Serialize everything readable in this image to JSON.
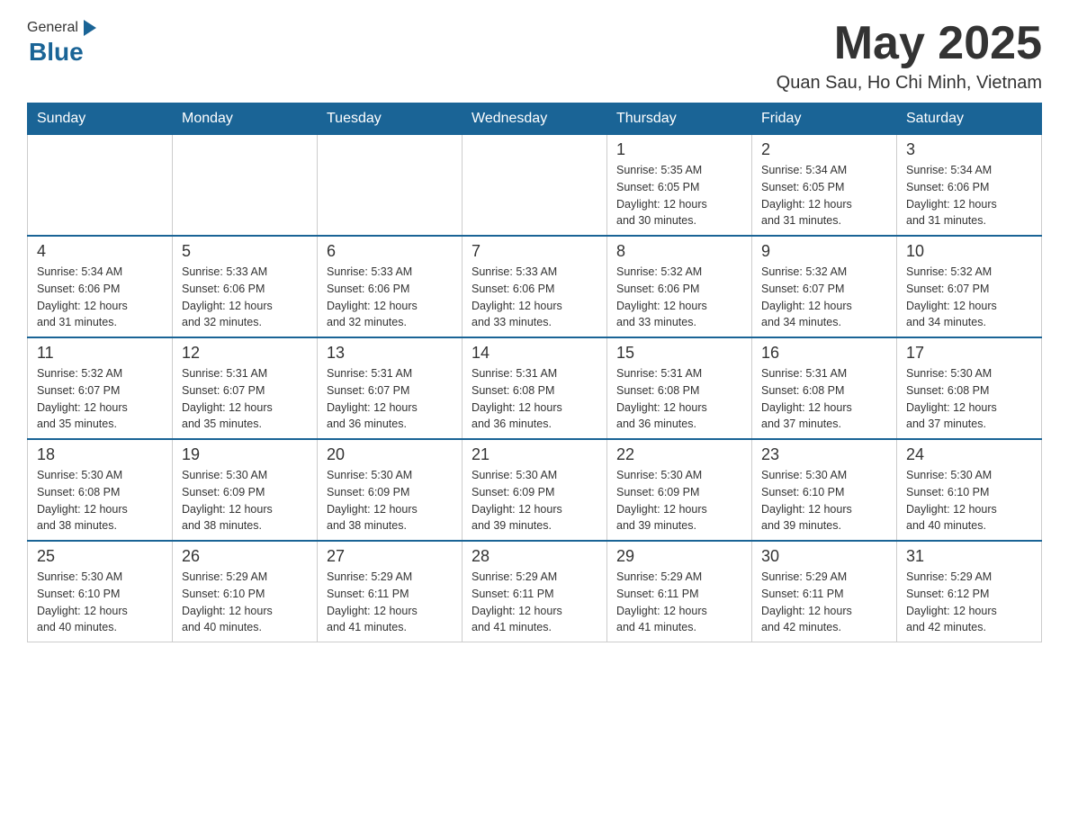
{
  "header": {
    "logo_general": "General",
    "logo_blue": "Blue",
    "month_title": "May 2025",
    "location": "Quan Sau, Ho Chi Minh, Vietnam"
  },
  "days_of_week": [
    "Sunday",
    "Monday",
    "Tuesday",
    "Wednesday",
    "Thursday",
    "Friday",
    "Saturday"
  ],
  "weeks": [
    [
      {
        "day": "",
        "info": ""
      },
      {
        "day": "",
        "info": ""
      },
      {
        "day": "",
        "info": ""
      },
      {
        "day": "",
        "info": ""
      },
      {
        "day": "1",
        "info": "Sunrise: 5:35 AM\nSunset: 6:05 PM\nDaylight: 12 hours\nand 30 minutes."
      },
      {
        "day": "2",
        "info": "Sunrise: 5:34 AM\nSunset: 6:05 PM\nDaylight: 12 hours\nand 31 minutes."
      },
      {
        "day": "3",
        "info": "Sunrise: 5:34 AM\nSunset: 6:06 PM\nDaylight: 12 hours\nand 31 minutes."
      }
    ],
    [
      {
        "day": "4",
        "info": "Sunrise: 5:34 AM\nSunset: 6:06 PM\nDaylight: 12 hours\nand 31 minutes."
      },
      {
        "day": "5",
        "info": "Sunrise: 5:33 AM\nSunset: 6:06 PM\nDaylight: 12 hours\nand 32 minutes."
      },
      {
        "day": "6",
        "info": "Sunrise: 5:33 AM\nSunset: 6:06 PM\nDaylight: 12 hours\nand 32 minutes."
      },
      {
        "day": "7",
        "info": "Sunrise: 5:33 AM\nSunset: 6:06 PM\nDaylight: 12 hours\nand 33 minutes."
      },
      {
        "day": "8",
        "info": "Sunrise: 5:32 AM\nSunset: 6:06 PM\nDaylight: 12 hours\nand 33 minutes."
      },
      {
        "day": "9",
        "info": "Sunrise: 5:32 AM\nSunset: 6:07 PM\nDaylight: 12 hours\nand 34 minutes."
      },
      {
        "day": "10",
        "info": "Sunrise: 5:32 AM\nSunset: 6:07 PM\nDaylight: 12 hours\nand 34 minutes."
      }
    ],
    [
      {
        "day": "11",
        "info": "Sunrise: 5:32 AM\nSunset: 6:07 PM\nDaylight: 12 hours\nand 35 minutes."
      },
      {
        "day": "12",
        "info": "Sunrise: 5:31 AM\nSunset: 6:07 PM\nDaylight: 12 hours\nand 35 minutes."
      },
      {
        "day": "13",
        "info": "Sunrise: 5:31 AM\nSunset: 6:07 PM\nDaylight: 12 hours\nand 36 minutes."
      },
      {
        "day": "14",
        "info": "Sunrise: 5:31 AM\nSunset: 6:08 PM\nDaylight: 12 hours\nand 36 minutes."
      },
      {
        "day": "15",
        "info": "Sunrise: 5:31 AM\nSunset: 6:08 PM\nDaylight: 12 hours\nand 36 minutes."
      },
      {
        "day": "16",
        "info": "Sunrise: 5:31 AM\nSunset: 6:08 PM\nDaylight: 12 hours\nand 37 minutes."
      },
      {
        "day": "17",
        "info": "Sunrise: 5:30 AM\nSunset: 6:08 PM\nDaylight: 12 hours\nand 37 minutes."
      }
    ],
    [
      {
        "day": "18",
        "info": "Sunrise: 5:30 AM\nSunset: 6:08 PM\nDaylight: 12 hours\nand 38 minutes."
      },
      {
        "day": "19",
        "info": "Sunrise: 5:30 AM\nSunset: 6:09 PM\nDaylight: 12 hours\nand 38 minutes."
      },
      {
        "day": "20",
        "info": "Sunrise: 5:30 AM\nSunset: 6:09 PM\nDaylight: 12 hours\nand 38 minutes."
      },
      {
        "day": "21",
        "info": "Sunrise: 5:30 AM\nSunset: 6:09 PM\nDaylight: 12 hours\nand 39 minutes."
      },
      {
        "day": "22",
        "info": "Sunrise: 5:30 AM\nSunset: 6:09 PM\nDaylight: 12 hours\nand 39 minutes."
      },
      {
        "day": "23",
        "info": "Sunrise: 5:30 AM\nSunset: 6:10 PM\nDaylight: 12 hours\nand 39 minutes."
      },
      {
        "day": "24",
        "info": "Sunrise: 5:30 AM\nSunset: 6:10 PM\nDaylight: 12 hours\nand 40 minutes."
      }
    ],
    [
      {
        "day": "25",
        "info": "Sunrise: 5:30 AM\nSunset: 6:10 PM\nDaylight: 12 hours\nand 40 minutes."
      },
      {
        "day": "26",
        "info": "Sunrise: 5:29 AM\nSunset: 6:10 PM\nDaylight: 12 hours\nand 40 minutes."
      },
      {
        "day": "27",
        "info": "Sunrise: 5:29 AM\nSunset: 6:11 PM\nDaylight: 12 hours\nand 41 minutes."
      },
      {
        "day": "28",
        "info": "Sunrise: 5:29 AM\nSunset: 6:11 PM\nDaylight: 12 hours\nand 41 minutes."
      },
      {
        "day": "29",
        "info": "Sunrise: 5:29 AM\nSunset: 6:11 PM\nDaylight: 12 hours\nand 41 minutes."
      },
      {
        "day": "30",
        "info": "Sunrise: 5:29 AM\nSunset: 6:11 PM\nDaylight: 12 hours\nand 42 minutes."
      },
      {
        "day": "31",
        "info": "Sunrise: 5:29 AM\nSunset: 6:12 PM\nDaylight: 12 hours\nand 42 minutes."
      }
    ]
  ]
}
